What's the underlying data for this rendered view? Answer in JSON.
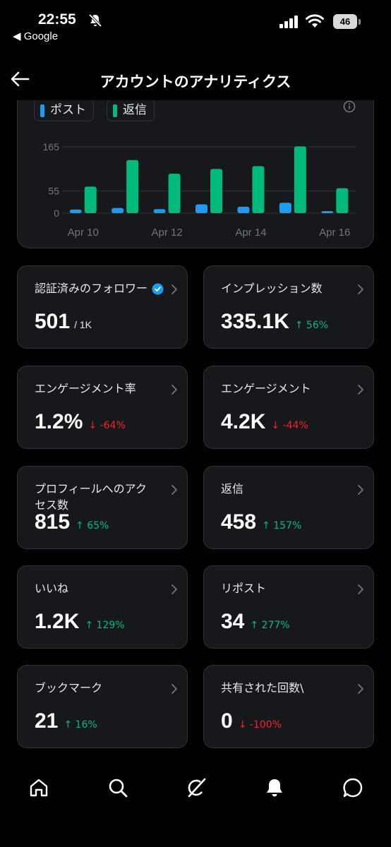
{
  "status_bar": {
    "time": "22:55",
    "back_app": "◀ Google",
    "battery": "46"
  },
  "header": {
    "title": "アカウントのアナリティクス"
  },
  "chart_data": {
    "type": "bar",
    "categories": [
      "Apr 10",
      "Apr 11",
      "Apr 12",
      "Apr 13",
      "Apr 14",
      "Apr 15",
      "Apr 16"
    ],
    "x_tick_labels": [
      "Apr 10",
      "Apr 12",
      "Apr 14",
      "Apr 16"
    ],
    "y_ticks": [
      "165",
      "55",
      "0"
    ],
    "ylim": [
      0,
      165
    ],
    "grid": true,
    "series": [
      {
        "name": "ポスト",
        "color": "#1d9bf0",
        "values": [
          9,
          13,
          10,
          22,
          16,
          26,
          5
        ]
      },
      {
        "name": "返信",
        "color": "#00ba7c",
        "values": [
          66,
          132,
          98,
          110,
          117,
          166,
          62
        ]
      }
    ]
  },
  "cards": [
    {
      "label": "認証済みのフォロワー",
      "value": "501",
      "sub": "/ 1K"
    },
    {
      "label": "インプレッション数",
      "value": "335.1K",
      "change": "↑ 56%",
      "dir": "up"
    },
    {
      "label": "エンゲージメント率",
      "value": "1.2%",
      "change": "↓ -64%",
      "dir": "down"
    },
    {
      "label": "エンゲージメント",
      "value": "4.2K",
      "change": "↓ -44%",
      "dir": "down"
    },
    {
      "label": "プロフィールへのアクセス数",
      "value": "815",
      "change": "↑ 65%",
      "dir": "up"
    },
    {
      "label": "返信",
      "value": "458",
      "change": "↑ 157%",
      "dir": "up"
    },
    {
      "label": "いいね",
      "value": "1.2K",
      "change": "↑ 129%",
      "dir": "up"
    },
    {
      "label": "リポスト",
      "value": "34",
      "change": "↑ 277%",
      "dir": "up"
    },
    {
      "label": "ブックマーク",
      "value": "21",
      "change": "↑ 16%",
      "dir": "up"
    },
    {
      "label": "共有された回数\\",
      "value": "0",
      "change": "↓ -100%",
      "dir": "down"
    }
  ],
  "icons": {
    "nav": [
      "home-icon",
      "search-icon",
      "grok-icon",
      "notifications-icon",
      "messages-icon"
    ]
  }
}
